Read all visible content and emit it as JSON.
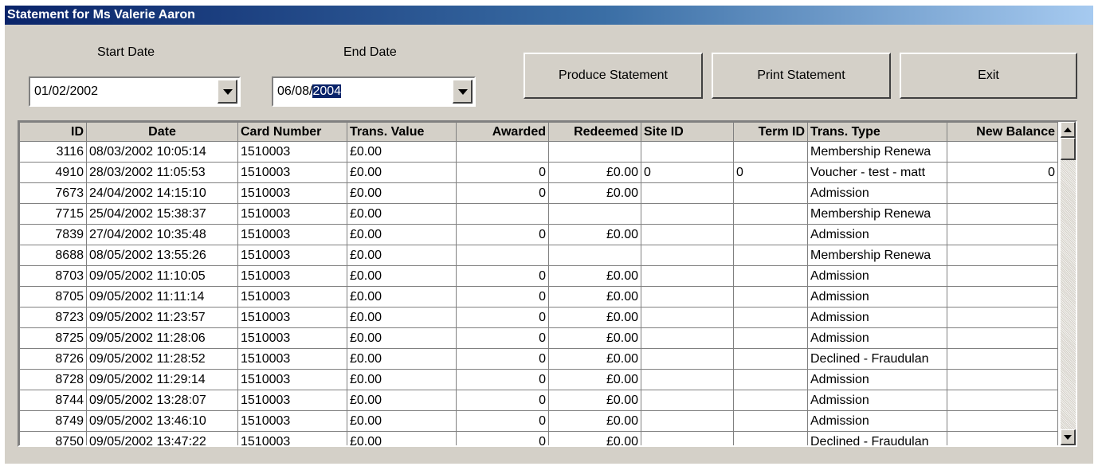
{
  "window": {
    "title": "Statement for Ms Valerie Aaron"
  },
  "filters": {
    "start_label": "Start Date",
    "start_value": "01/02/2002",
    "end_label": "End Date",
    "end_value_unselected": "06/08/",
    "end_value_selected": "2004"
  },
  "buttons": {
    "produce": "Produce Statement",
    "print": "Print Statement",
    "exit": "Exit"
  },
  "table": {
    "headers": [
      "ID",
      "Date",
      "Card Number",
      "Trans. Value",
      "Awarded",
      "Redeemed",
      "Site ID",
      "Term ID",
      "Trans. Type",
      "New Balance"
    ],
    "rows": [
      [
        "3116",
        "08/03/2002 10:05:14",
        "1510003",
        "£0.00",
        "",
        "",
        "",
        "",
        "Membership Renewa",
        ""
      ],
      [
        "4910",
        "28/03/2002 11:05:53",
        "1510003",
        "£0.00",
        "0",
        "£0.00",
        "0",
        "0",
        "Voucher - test - matt",
        "0"
      ],
      [
        "7673",
        "24/04/2002 14:15:10",
        "1510003",
        "£0.00",
        "0",
        "£0.00",
        "",
        "",
        "Admission",
        ""
      ],
      [
        "7715",
        "25/04/2002 15:38:37",
        "1510003",
        "£0.00",
        "",
        "",
        "",
        "",
        "Membership Renewa",
        ""
      ],
      [
        "7839",
        "27/04/2002 10:35:48",
        "1510003",
        "£0.00",
        "0",
        "£0.00",
        "",
        "",
        "Admission",
        ""
      ],
      [
        "8688",
        "08/05/2002 13:55:26",
        "1510003",
        "£0.00",
        "",
        "",
        "",
        "",
        "Membership Renewa",
        ""
      ],
      [
        "8703",
        "09/05/2002 11:10:05",
        "1510003",
        "£0.00",
        "0",
        "£0.00",
        "",
        "",
        "Admission",
        ""
      ],
      [
        "8705",
        "09/05/2002 11:11:14",
        "1510003",
        "£0.00",
        "0",
        "£0.00",
        "",
        "",
        "Admission",
        ""
      ],
      [
        "8723",
        "09/05/2002 11:23:57",
        "1510003",
        "£0.00",
        "0",
        "£0.00",
        "",
        "",
        "Admission",
        ""
      ],
      [
        "8725",
        "09/05/2002 11:28:06",
        "1510003",
        "£0.00",
        "0",
        "£0.00",
        "",
        "",
        "Admission",
        ""
      ],
      [
        "8726",
        "09/05/2002 11:28:52",
        "1510003",
        "£0.00",
        "0",
        "£0.00",
        "",
        "",
        "Declined - Fraudulan",
        ""
      ],
      [
        "8728",
        "09/05/2002 11:29:14",
        "1510003",
        "£0.00",
        "0",
        "£0.00",
        "",
        "",
        "Admission",
        ""
      ],
      [
        "8744",
        "09/05/2002 13:28:07",
        "1510003",
        "£0.00",
        "0",
        "£0.00",
        "",
        "",
        "Admission",
        ""
      ],
      [
        "8749",
        "09/05/2002 13:46:10",
        "1510003",
        "£0.00",
        "0",
        "£0.00",
        "",
        "",
        "Admission",
        ""
      ],
      [
        "8750",
        "09/05/2002 13:47:22",
        "1510003",
        "£0.00",
        "0",
        "£0.00",
        "",
        "",
        "Declined - Fraudulan",
        ""
      ]
    ]
  },
  "icons": {
    "start_dropdown": "chevron-down-icon",
    "end_dropdown": "chevron-down-icon",
    "scroll_up": "arrow-up-icon",
    "scroll_down": "arrow-down-icon"
  },
  "colors": {
    "title_start": "#0a246a",
    "title_end": "#a6caf0",
    "window_bg": "#d4d0c8",
    "selection": "#0a246a"
  }
}
